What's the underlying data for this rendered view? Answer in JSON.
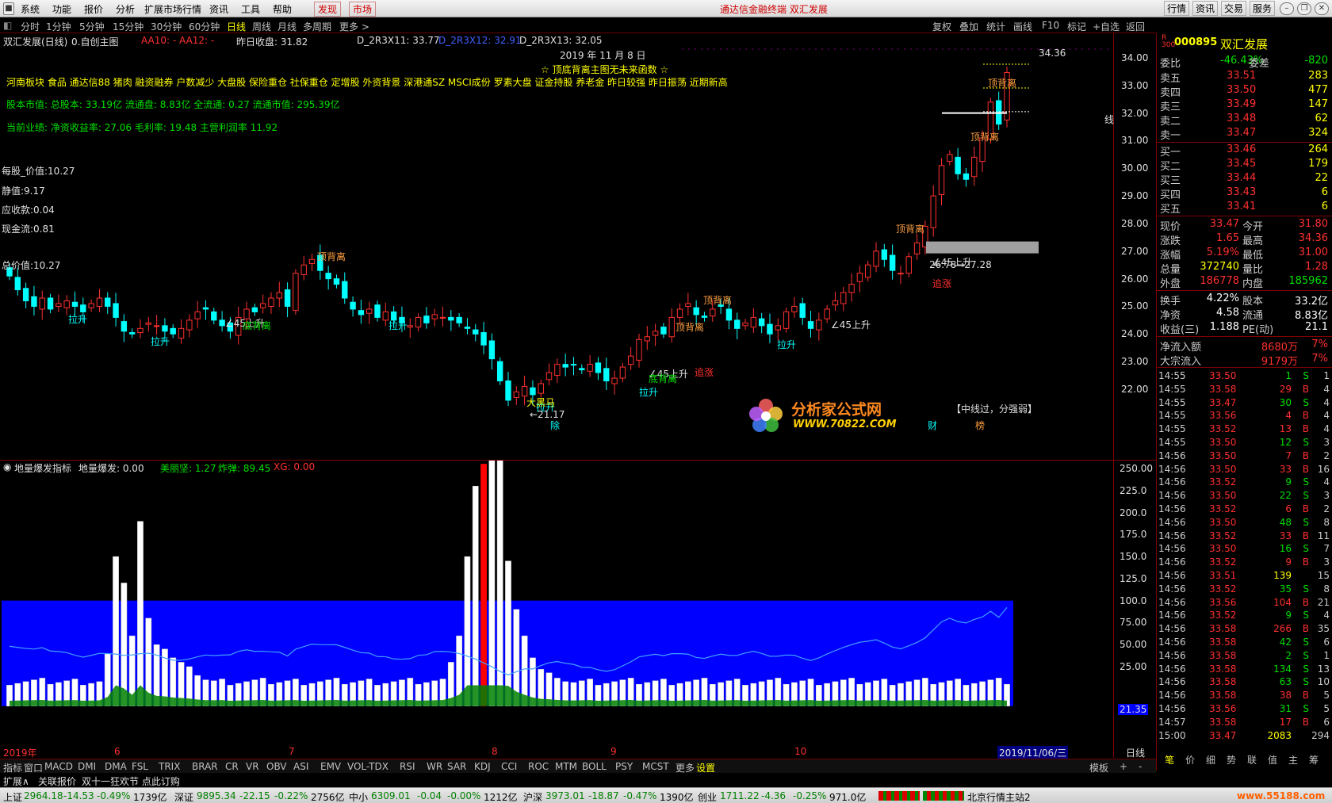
{
  "menu": {
    "items": [
      "系统",
      "功能",
      "报价",
      "分析",
      "扩展市场行情",
      "资讯",
      "工具",
      "帮助"
    ],
    "hot_items": [
      "发现",
      "市场"
    ],
    "title": "通达信金融终端  双汇发展",
    "right_items": [
      "行情",
      "资讯",
      "交易",
      "服务"
    ]
  },
  "periods": {
    "items": [
      "分时",
      "1分钟",
      "5分钟",
      "15分钟",
      "30分钟",
      "60分钟",
      "日线",
      "周线",
      "月线",
      "多周期",
      "更多 >"
    ],
    "selected": "日线",
    "tools": [
      "复权",
      "叠加",
      "统计",
      "画线",
      "F10",
      "标记",
      "+自选",
      "返回"
    ]
  },
  "chart": {
    "title": "双汇发展(日线)",
    "custom_label": "0.自创主图",
    "aa": "AA10: - AA12: -",
    "prev_close": "昨日收盘: 31.82",
    "d11": "D_2R3X11: 33.77",
    "d12": "D_2R3X12: 32.91",
    "d13": "D_2R3X13: 32.05",
    "date": "2019 年 11 月 8 日",
    "notice": "☆ 顶底背离主图无未来函数 ☆",
    "concepts": "河南板块 食品 通达信88 猪肉 融资融券 户数减少 大盘股 保险重仓 社保重仓 定增股 外资背景 深港通SZ MSCI成份 罗素大盘 证金持股 养老金 昨日较强 昨日振荡 近期新高",
    "capital": "股本市值: 总股本: 33.19亿 流通盘: 8.83亿 全流通: 0.27 流通市值: 295.39亿",
    "performance": "当前业绩:  净资收益率: 27.06 毛利率: 19.48 主营利润率 11.92",
    "eps": "每股_价值:10.27",
    "static": "静值:9.17",
    "receivable": "应收款:0.04",
    "cashflow": "现金流:0.81",
    "total_value": "总价值:10.27",
    "max_label": "34.36",
    "line_label": "线",
    "midline_note": "【中线过，分强弱】",
    "watermark_cn": "分析家公式网",
    "watermark_url": "WWW.70822.COM",
    "yticks": [
      "34.00",
      "33.00",
      "32.00",
      "31.00",
      "30.00",
      "29.00",
      "28.00",
      "27.00",
      "26.00",
      "25.00",
      "24.00",
      "23.00",
      "22.00"
    ],
    "annotations": [
      {
        "text": "顶背离",
        "cls": "orange"
      },
      {
        "text": "顶背离",
        "cls": "orange"
      },
      {
        "text": "顶背离",
        "cls": "orange"
      },
      {
        "text": "顶背离",
        "cls": "orange"
      },
      {
        "text": "顶背离",
        "cls": "orange"
      },
      {
        "text": "顶背离",
        "cls": "orange"
      },
      {
        "text": "拉升",
        "cls": "cyan"
      },
      {
        "text": "拉升",
        "cls": "cyan"
      },
      {
        "text": "拉升",
        "cls": "cyan"
      },
      {
        "text": "拉升",
        "cls": "cyan"
      },
      {
        "text": "拉升",
        "cls": "cyan"
      },
      {
        "text": "拉升",
        "cls": "cyan"
      },
      {
        "text": "∠45上升",
        "cls": "white"
      },
      {
        "text": "∠45上升",
        "cls": "white"
      },
      {
        "text": "∠45上升",
        "cls": "white"
      },
      {
        "text": "∠45上升",
        "cls": "white"
      },
      {
        "text": "底背离",
        "cls": "green"
      },
      {
        "text": "底背离",
        "cls": "green"
      },
      {
        "text": "追涨",
        "cls": "red"
      },
      {
        "text": "追涨",
        "cls": "red"
      },
      {
        "text": "大黑马",
        "cls": "yellow"
      },
      {
        "text": "←21.17",
        "cls": "white"
      },
      {
        "text": "26.78→27.28",
        "cls": "white"
      },
      {
        "text": "除",
        "cls": "cyan"
      },
      {
        "text": "财",
        "cls": "cyan"
      },
      {
        "text": "榜",
        "cls": "orange"
      }
    ]
  },
  "indicator": {
    "name": "地量爆发指标",
    "value": "地量爆发: 0.00",
    "meili": "美丽坚: 1.27",
    "zhadan": "炸弹: 89.45",
    "xg": "XG: 0.00",
    "yticks": [
      "250.00",
      "225.0",
      "200.0",
      "175.0",
      "150.0",
      "125.0",
      "100.0",
      "75.00",
      "50.00",
      "25.00"
    ],
    "cursor_value": "21.35",
    "month_labels": [
      "2019年",
      "6",
      "7",
      "8",
      "9",
      "10"
    ],
    "cursor_date": "2019/11/06/三",
    "period_label": "日线"
  },
  "quote": {
    "code": "000895",
    "name": "双汇发展",
    "weibi_label": "委比",
    "weibi": "-46.43%",
    "weicha_label": "委差",
    "weicha": "-820",
    "asks": [
      {
        "label": "卖五",
        "price": "33.51",
        "vol": "283"
      },
      {
        "label": "卖四",
        "price": "33.50",
        "vol": "477"
      },
      {
        "label": "卖三",
        "price": "33.49",
        "vol": "147"
      },
      {
        "label": "卖二",
        "price": "33.48",
        "vol": "62"
      },
      {
        "label": "卖一",
        "price": "33.47",
        "vol": "324"
      }
    ],
    "bids": [
      {
        "label": "买一",
        "price": "33.46",
        "vol": "264"
      },
      {
        "label": "买二",
        "price": "33.45",
        "vol": "179"
      },
      {
        "label": "买三",
        "price": "33.44",
        "vol": "22"
      },
      {
        "label": "买四",
        "price": "33.43",
        "vol": "6"
      },
      {
        "label": "买五",
        "price": "33.41",
        "vol": "6"
      }
    ],
    "stats": [
      {
        "l1": "现价",
        "v1": "33.47",
        "l2": "今开",
        "v2": "31.80"
      },
      {
        "l1": "涨跌",
        "v1": "1.65",
        "l2": "最高",
        "v2": "34.36"
      },
      {
        "l1": "涨幅",
        "v1": "5.19%",
        "l2": "最低",
        "v2": "31.00"
      },
      {
        "l1": "总量",
        "v1": "372740",
        "l2": "量比",
        "v2": "1.28"
      },
      {
        "l1": "外盘",
        "v1": "186778",
        "l2": "内盘",
        "v2": "185962"
      }
    ],
    "stats2": [
      {
        "l1": "换手",
        "v1": "4.22%",
        "l2": "股本",
        "v2": "33.2亿"
      },
      {
        "l1": "净资",
        "v1": "4.58",
        "l2": "流通",
        "v2": "8.83亿"
      },
      {
        "l1": "收益(三)",
        "v1": "1.188",
        "l2": "PE(动)",
        "v2": "21.1"
      }
    ],
    "flows": [
      {
        "label": "净流入额",
        "value": "8680万",
        "pct": "7%"
      },
      {
        "label": "大宗流入",
        "value": "9179万",
        "pct": "7%"
      }
    ],
    "ticks": [
      [
        "14:55",
        "33.50",
        "1",
        "S",
        "1"
      ],
      [
        "14:55",
        "33.58",
        "29",
        "B",
        "4"
      ],
      [
        "14:55",
        "33.47",
        "30",
        "S",
        "4"
      ],
      [
        "14:55",
        "33.56",
        "4",
        "B",
        "4"
      ],
      [
        "14:55",
        "33.52",
        "13",
        "B",
        "4"
      ],
      [
        "14:55",
        "33.50",
        "12",
        "S",
        "3"
      ],
      [
        "14:56",
        "33.50",
        "7",
        "B",
        "2"
      ],
      [
        "14:56",
        "33.50",
        "33",
        "B",
        "16"
      ],
      [
        "14:56",
        "33.52",
        "9",
        "S",
        "4"
      ],
      [
        "14:56",
        "33.50",
        "22",
        "S",
        "3"
      ],
      [
        "14:56",
        "33.52",
        "6",
        "B",
        "2"
      ],
      [
        "14:56",
        "33.50",
        "48",
        "S",
        "8"
      ],
      [
        "14:56",
        "33.52",
        "33",
        "B",
        "11"
      ],
      [
        "14:56",
        "33.50",
        "16",
        "S",
        "7"
      ],
      [
        "14:56",
        "33.52",
        "9",
        "B",
        "3"
      ],
      [
        "14:56",
        "33.51",
        "139",
        "",
        "15"
      ],
      [
        "14:56",
        "33.52",
        "35",
        "S",
        "8"
      ],
      [
        "14:56",
        "33.56",
        "104",
        "B",
        "21"
      ],
      [
        "14:56",
        "33.52",
        "9",
        "S",
        "4"
      ],
      [
        "14:56",
        "33.58",
        "266",
        "B",
        "35"
      ],
      [
        "14:56",
        "33.58",
        "42",
        "S",
        "6"
      ],
      [
        "14:56",
        "33.58",
        "2",
        "S",
        "1"
      ],
      [
        "14:56",
        "33.58",
        "134",
        "S",
        "13"
      ],
      [
        "14:56",
        "33.58",
        "63",
        "S",
        "10"
      ],
      [
        "14:56",
        "33.58",
        "38",
        "B",
        "5"
      ],
      [
        "14:56",
        "33.56",
        "31",
        "S",
        "5"
      ],
      [
        "14:57",
        "33.58",
        "17",
        "B",
        "6"
      ],
      [
        "15:00",
        "33.47",
        "2083",
        "",
        "294"
      ]
    ],
    "bottom_tabs": [
      "笔",
      "价",
      "细",
      "势",
      "联",
      "值",
      "主",
      "筹"
    ]
  },
  "tabs": [
    "指标",
    "窗口",
    "MACD",
    "DMI",
    "DMA",
    "FSL",
    "TRIX",
    "BRAR",
    "CR",
    "VR",
    "OBV",
    "ASI",
    "EMV",
    "VOL-TDX",
    "RSI",
    "WR",
    "SAR",
    "KDJ",
    "CCI",
    "ROC",
    "MTM",
    "BOLL",
    "PSY",
    "MCST",
    "更多",
    "设置"
  ],
  "tabs_right": [
    "模板",
    "+",
    "-"
  ],
  "expand": {
    "label": "扩展∧",
    "link": "关联报价",
    "promo": "双十一狂欢节 点此订购"
  },
  "status": {
    "sh": {
      "name": "上证",
      "v": "2964.18",
      "c": "-14.53",
      "p": "-0.49%",
      "amt": "1739亿"
    },
    "sz": {
      "name": "深证",
      "v": "9895.34",
      "c": "-22.15",
      "p": "-0.22%",
      "amt": "2756亿"
    },
    "zx": {
      "name": "中小",
      "v": "6309.01",
      "c": "-0.04",
      "p": "-0.00%",
      "amt": "1212亿"
    },
    "hs": {
      "name": "沪深",
      "v": "3973.01",
      "c": "-18.87",
      "p": "-0.47%",
      "amt": "1390亿"
    },
    "cy": {
      "name": "创业",
      "v": "1711.22",
      "c": "-4.36",
      "p": "-0.25%",
      "amt": "971.0亿"
    },
    "server": "北京行情主站2",
    "site": "www.55188.com"
  },
  "colors": {
    "up": "#ff3030",
    "down": "#00ffff",
    "bg": "#000000",
    "grid": "#800000",
    "blue_band": "#0000ff"
  }
}
